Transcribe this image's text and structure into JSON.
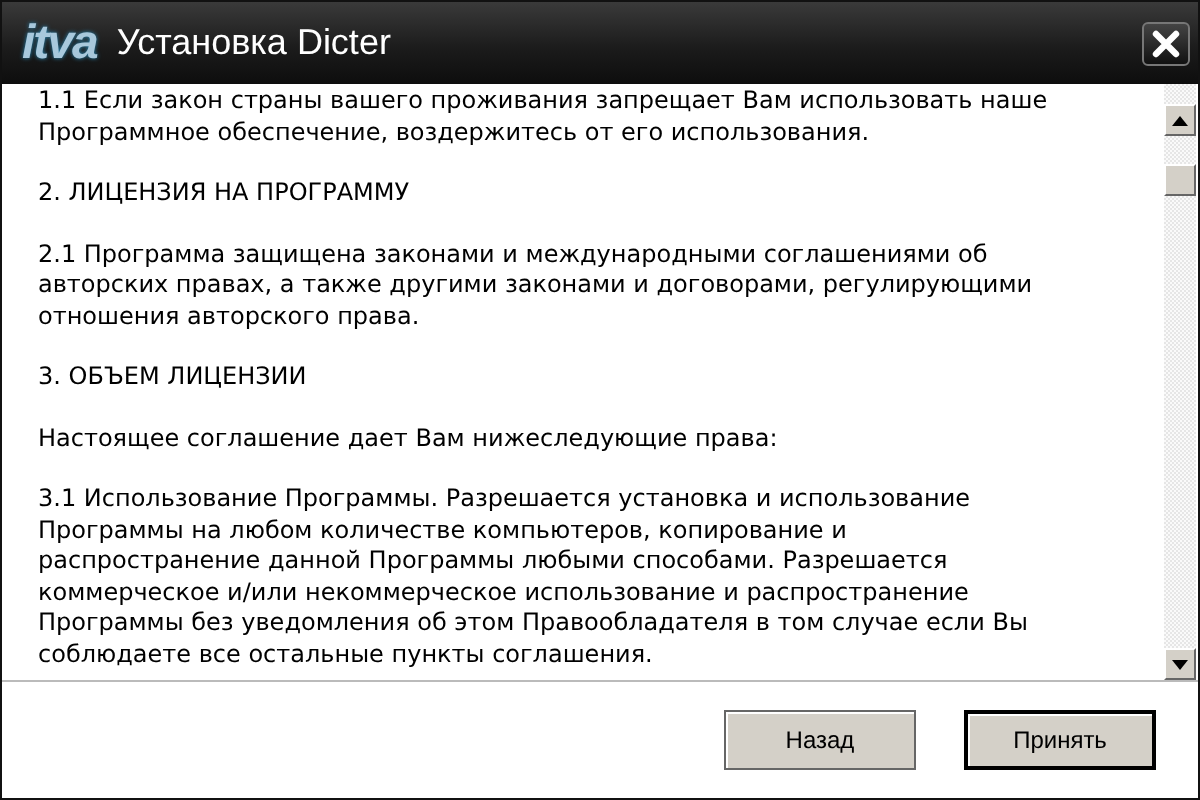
{
  "window": {
    "logo": "itva",
    "title": "Установка Dicter"
  },
  "license": {
    "paragraphs": [
      {
        "lines": [
          "1.1 Если закон страны вашего проживания запрещает Вам использовать наше",
          "Программное обеспечение, воздержитесь от его использования."
        ]
      },
      {
        "lines": [
          "2. ЛИЦЕНЗИЯ НА ПРОГРАММУ"
        ]
      },
      {
        "lines": [
          "2.1 Программа защищена законами и международными соглашениями об",
          "авторских правах, а также другими законами и договорами, регулирующими",
          "отношения авторского права."
        ]
      },
      {
        "lines": [
          "3. ОБЪЕМ ЛИЦЕНЗИИ"
        ]
      },
      {
        "lines": [
          "Настоящее соглашение дает Вам нижеследующие права:"
        ]
      },
      {
        "lines": [
          "3.1 Использование Программы. Разрешается установка и использование",
          "Программы на любом количестве компьютеров, копирование и",
          "распространение данной Программы любыми способами. Разрешается",
          "коммерческое и/или некоммерческое использование и распространение",
          "Программы без уведомления об этом Правообладателя в том случае если Вы",
          "соблюдаете все остальные пункты соглашения."
        ]
      }
    ]
  },
  "buttons": [
    {
      "label": "Назад",
      "default": false
    },
    {
      "label": "Принять",
      "default": true
    }
  ]
}
